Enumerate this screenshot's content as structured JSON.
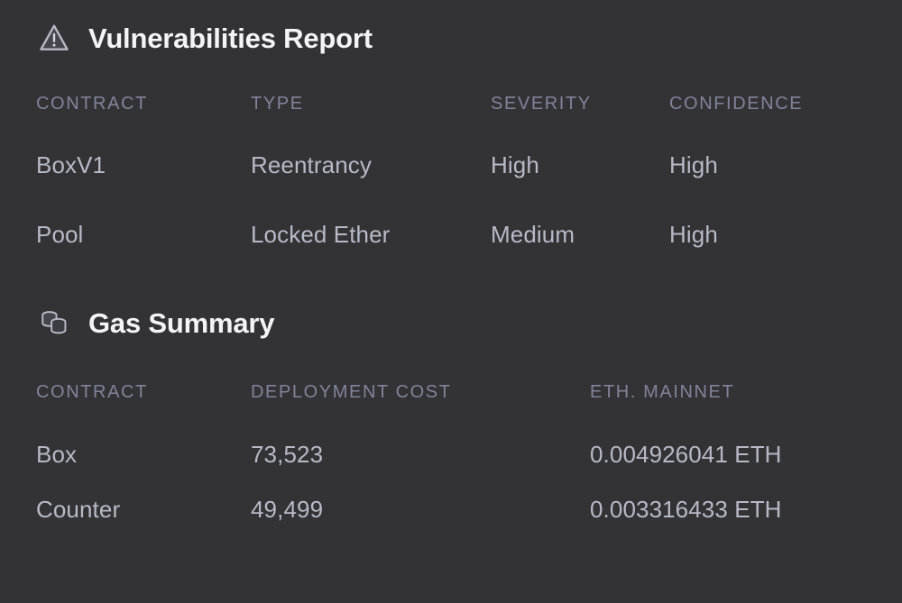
{
  "theme": {
    "background": "#333336",
    "title_color": "#f4f4f6",
    "header_color": "#82839a",
    "body_color": "#b8b9c7",
    "icon_color": "#b8b9c7"
  },
  "vulnerabilities": {
    "icon": "warning-triangle-icon",
    "title": "Vulnerabilities Report",
    "columns": [
      "CONTRACT",
      "TYPE",
      "SEVERITY",
      "CONFIDENCE"
    ],
    "rows": [
      {
        "contract": "BoxV1",
        "type": "Reentrancy",
        "severity": "High",
        "confidence": "High"
      },
      {
        "contract": "Pool",
        "type": "Locked Ether",
        "severity": "Medium",
        "confidence": "High"
      }
    ]
  },
  "gas_summary": {
    "icon": "coins-stack-icon",
    "title": "Gas Summary",
    "columns": [
      "CONTRACT",
      "DEPLOYMENT COST",
      "ETH. MAINNET"
    ],
    "rows": [
      {
        "contract": "Box",
        "deployment_cost": "73,523",
        "eth_mainnet": "0.004926041 ETH"
      },
      {
        "contract": "Counter",
        "deployment_cost": "49,499",
        "eth_mainnet": "0.003316433 ETH"
      }
    ]
  }
}
